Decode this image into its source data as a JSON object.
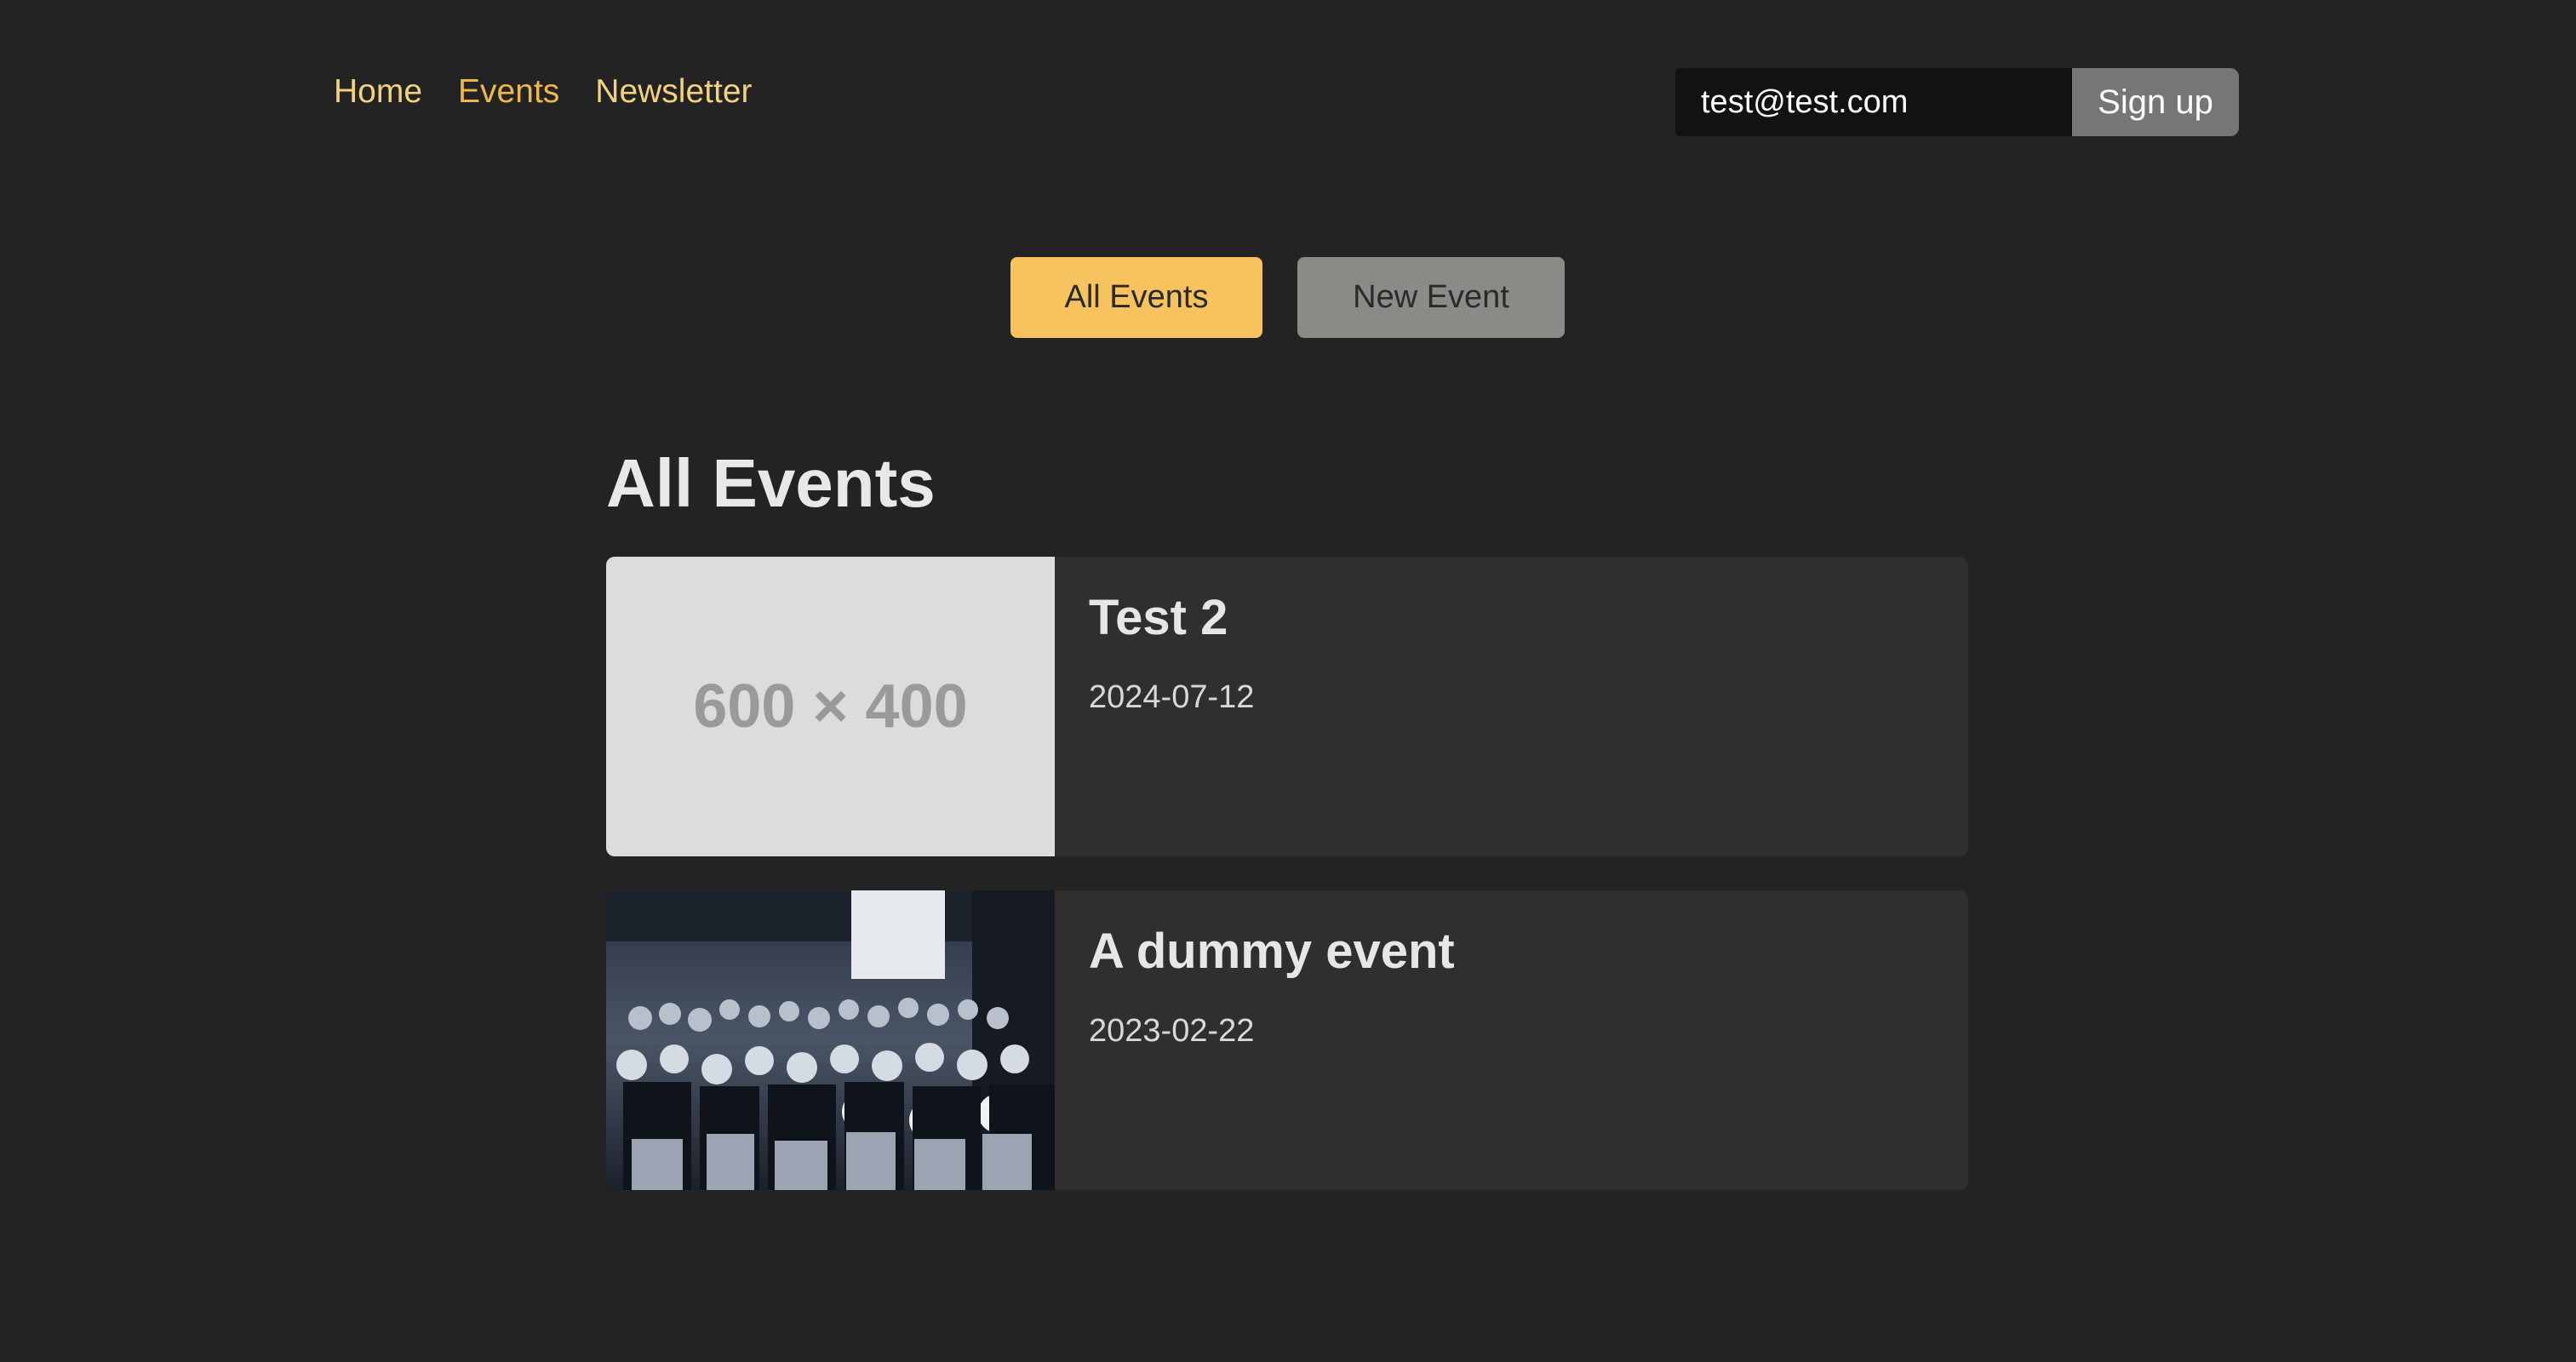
{
  "nav": {
    "home": "Home",
    "events": "Events",
    "newsletter": "Newsletter"
  },
  "signup": {
    "email_value": "test@test.com",
    "button_label": "Sign up"
  },
  "actions": {
    "all_events": "All Events",
    "new_event": "New Event"
  },
  "page": {
    "heading": "All Events"
  },
  "events": [
    {
      "title": "Test 2",
      "date": "2024-07-12",
      "image_text": "600 × 400",
      "image_kind": "placeholder"
    },
    {
      "title": "A dummy event",
      "date": "2023-02-22",
      "image_kind": "audience-photo"
    }
  ],
  "colors": {
    "background": "#232323",
    "nav_link": "#f2d27e",
    "nav_active": "#f0b74f",
    "primary_button": "#f7c35f",
    "secondary_button": "#8a8a86",
    "card": "#302f2d"
  }
}
